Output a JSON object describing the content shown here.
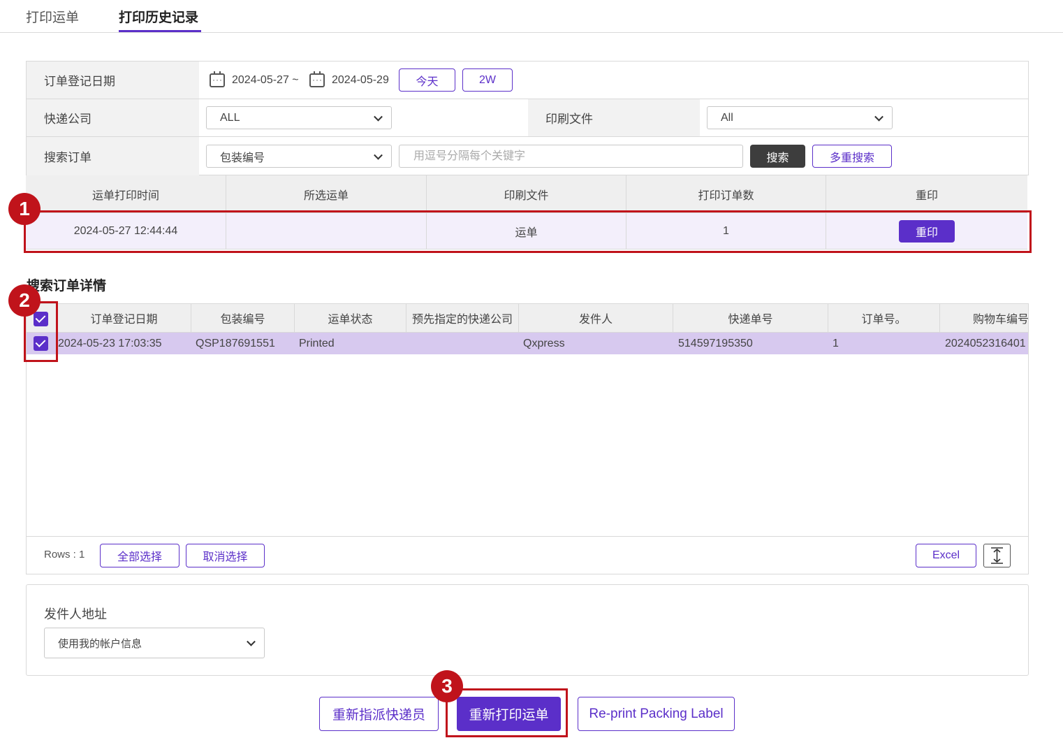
{
  "tabs": [
    {
      "label": "打印运单"
    },
    {
      "label": "打印历史记录"
    }
  ],
  "filter": {
    "date_label": "订单登记日期",
    "date_from": "2024-05-27 ~",
    "date_to": "2024-05-29",
    "today_btn": "今天",
    "two_week_btn": "2W",
    "courier_label": "快递公司",
    "courier_value": "ALL",
    "print_doc_label": "印刷文件",
    "print_doc_value": "All",
    "search_label": "搜索订单",
    "search_type_value": "包装编号",
    "search_placeholder": "用逗号分隔每个关键字",
    "search_btn": "搜索",
    "multi_search_btn": "多重搜索"
  },
  "history_table": {
    "columns": [
      "运单打印时间",
      "所选运单",
      "印刷文件",
      "打印订单数",
      "重印"
    ],
    "rows": [
      {
        "time": "2024-05-27 12:44:44",
        "selected": "",
        "doc": "运单",
        "count": "1",
        "reprint_btn": "重印"
      }
    ]
  },
  "detail": {
    "title": "搜索订单详情",
    "columns": [
      "订单登记日期",
      "包装编号",
      "运单状态",
      "预先指定的快递公司",
      "发件人",
      "快递单号",
      "订单号。",
      "购物车编号"
    ],
    "rows": [
      {
        "date": "2024-05-23 17:03:35",
        "package_no": "QSP187691551",
        "status": "Printed",
        "preassigned": "",
        "sender": "Qxpress",
        "tracking_no": "514597195350",
        "order_no": "1",
        "cart_no": "2024052316401",
        "checked": true
      }
    ],
    "rows_count": "Rows : 1",
    "select_all_btn": "全部选择",
    "deselect_btn": "取消选择",
    "excel_btn": "Excel"
  },
  "sender_address": {
    "label": "发件人地址",
    "value": "使用我的帐户信息"
  },
  "actions": {
    "reassign_btn": "重新指派快递员",
    "reprint_waybill_btn": "重新打印运单",
    "reprint_packing_btn": "Re-print Packing Label"
  },
  "annotations": {
    "badge1": "1",
    "badge2": "2",
    "badge3": "3"
  },
  "colors": {
    "accent": "#5b2fc9",
    "highlight": "#c0131b",
    "selected_row": "#d7c9ef"
  }
}
